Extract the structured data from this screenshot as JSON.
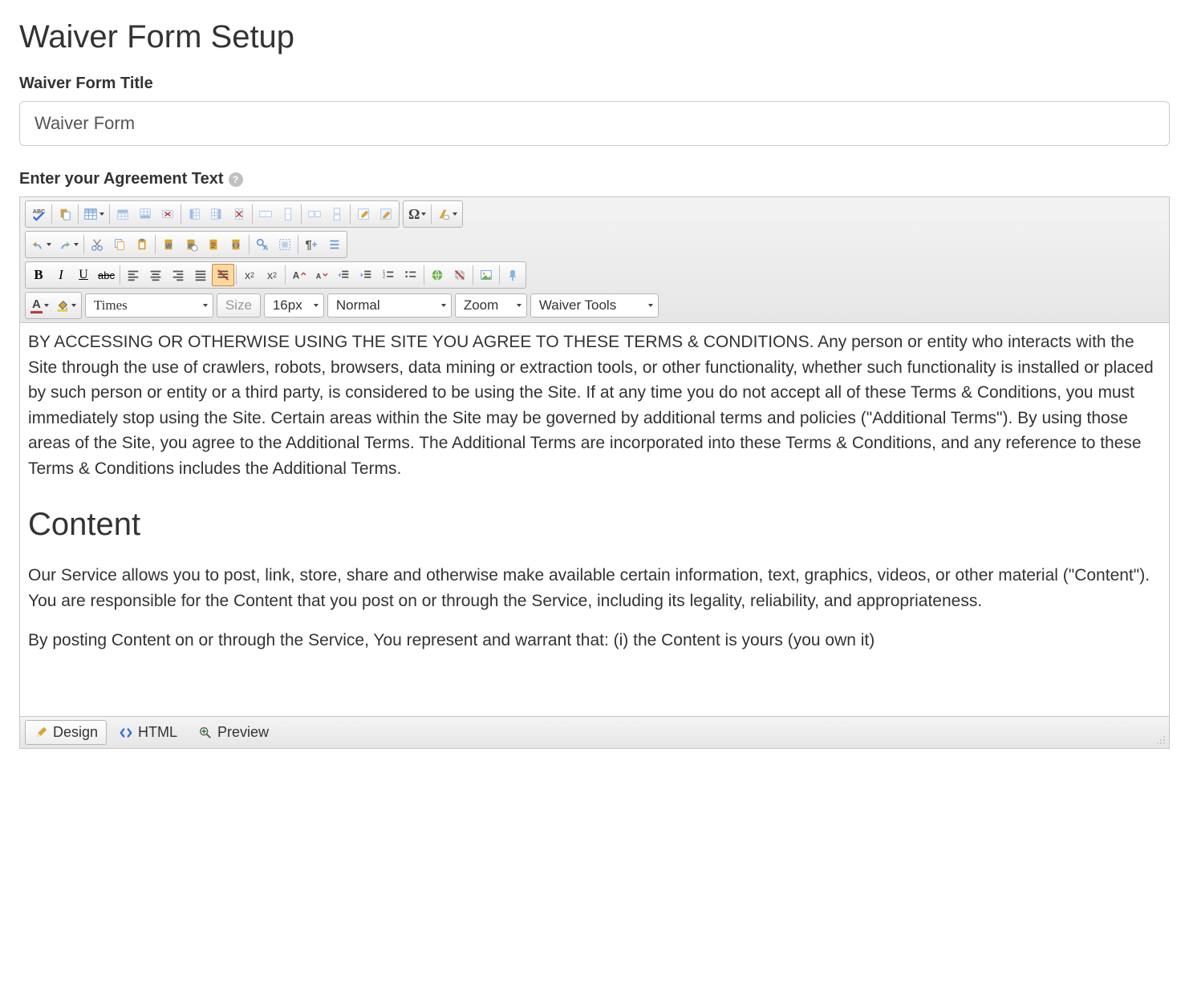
{
  "page": {
    "title": "Waiver Form Setup"
  },
  "title_field": {
    "label": "Waiver Form Title",
    "value": "Waiver Form"
  },
  "agreement_field": {
    "label": "Enter your Agreement Text"
  },
  "editor": {
    "font_family": "Times",
    "size_label": "Size",
    "size_value": "16px",
    "paragraph": "Normal",
    "zoom": "Zoom",
    "waiver_tools": "Waiver Tools",
    "omega": "Ω",
    "bold": "B",
    "italic": "I",
    "underline": "U",
    "strike": "abc",
    "sup_label": "x",
    "sup_exp": "2",
    "sub_label": "x",
    "sub_exp": "2",
    "font_color_a": "A",
    "bg_color_glyph": "◇",
    "para_glyph": "¶",
    "content": {
      "p1": "BY ACCESSING OR OTHERWISE USING THE SITE YOU AGREE TO THESE TERMS & CONDITIONS. Any person or entity who interacts with the Site through the use of crawlers, robots, browsers, data mining or extraction tools, or other functionality, whether such functionality is installed or placed by such person or entity or a third party, is considered to be using the Site. If at any time you do not accept all of these Terms & Conditions, you must immediately stop using the Site. Certain areas within the Site may be governed by additional terms and policies (\"Additional Terms\"). By using those areas of the Site, you agree to the Additional Terms. The Additional Terms are incorporated into these Terms & Conditions, and any reference to these Terms & Conditions includes the Additional Terms.",
      "h_content": "Content",
      "p2": "Our Service allows you to post, link, store, share and otherwise make available certain information, text, graphics, videos, or other material (\"Content\"). You are responsible for the Content that you post on or through the Service, including its legality, reliability, and appropriateness.",
      "p3": "By posting Content on or through the Service, You represent and warrant that: (i) the Content is yours (you own it)"
    }
  },
  "footer": {
    "design": "Design",
    "html": "HTML",
    "preview": "Preview"
  }
}
